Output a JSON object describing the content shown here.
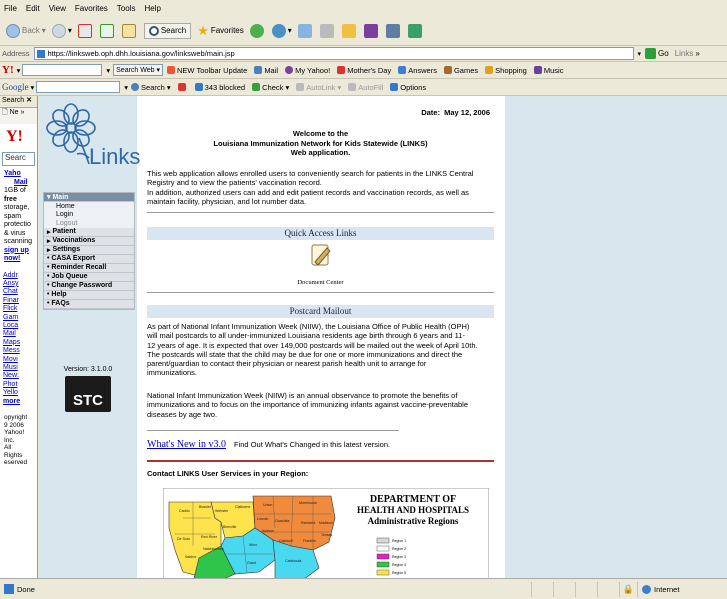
{
  "menubar": {
    "items": [
      "File",
      "Edit",
      "View",
      "Favorites",
      "Tools",
      "Help"
    ]
  },
  "toolbar": {
    "back_label": "Back",
    "search_label": "Search",
    "favorites_label": "Favorites"
  },
  "address": {
    "label": "Address",
    "url": "https://linksweb.oph.dhh.louisiana.gov/linksweb/main.jsp",
    "go_label": "Go",
    "links_label": "Links"
  },
  "yahoo_toolbar": {
    "search_web_label": "Search Web",
    "items": [
      "NEW Toolbar Update",
      "Mail",
      "My Yahoo!",
      "Mother's Day",
      "Answers",
      "Games",
      "Shopping",
      "Music"
    ]
  },
  "google_toolbar": {
    "logo": "Google",
    "search_label": "Search",
    "blocked_label": "343 blocked",
    "check_label": "Check",
    "autolink_label": "AutoLink",
    "autofill_label": "AutoFill",
    "options_label": "Options"
  },
  "side_panel": {
    "header": "Search",
    "search_placeholder": "Searc",
    "promo_lines": [
      "Yaho",
      "Mail",
      "1GB of",
      "free",
      "storage,",
      "spam",
      "protectio",
      "& virus",
      "scanning",
      "sign up",
      "now!"
    ],
    "links": [
      "Addr",
      "Ansy",
      "Chat",
      "Finar",
      "Flick",
      "Gam",
      "Loca",
      "Mail",
      "Maps",
      "Mess",
      "Movi",
      "Musi",
      "New:",
      "Phot",
      "Yello",
      "more"
    ],
    "copyright": [
      "opyright",
      "9 2006",
      "Yahoo!",
      "Inc.",
      "All",
      "Rights",
      "eserved"
    ]
  },
  "nav": {
    "logo_text": "Links",
    "main_label": "Main",
    "sub_items": [
      "Home",
      "Login",
      "Logout"
    ],
    "items": [
      "Patient",
      "Vaccinations",
      "Settings",
      "CASA Export",
      "Reminder Recall",
      "Job Queue",
      "Change Password",
      "Help",
      "FAQs"
    ],
    "version": "Version: 3.1.0.0",
    "stc_logo": "STC"
  },
  "content": {
    "date_label": "Date:",
    "date_value": "May 12, 2006",
    "welcome_lines": [
      "Welcome to the",
      "Louisiana Immunization Network for Kids Statewide (LINKS)",
      "Web application."
    ],
    "intro_lines": [
      "This web application allows enrolled users to conveniently search for patients in the LINKS Central",
      "Registry and to view the patients' vaccination record.",
      "In addition, authorized users can add and edit patient records and vaccination records, as well as",
      "maintain facility, physician, and lot number data."
    ],
    "quick_access_heading": "Quick Access Links",
    "document_center_label": "Document Center",
    "postcard_heading": "Postcard Mailout",
    "postcard_p1_lines": [
      "As part of National Infant Immunization Week (NIIW), the Louisiana Office of Public Health (OPH)",
      "will mail postcards to all under-immunized Louisiana residents age birth through 6 years and 11-",
      "12 years of age. It is expected that over 149,000 postcards will be mailed out the week of April 10th.",
      "The postcards will state that the child may be due for one or more immunizations and direct the",
      "parent/guardian to contact their physician or nearest parish health unit to arrange for",
      "immunizations."
    ],
    "postcard_p2_lines": [
      "National Infant Immunization Week (NIIW) is an annual observance to promote the benefits of",
      "immunizations and to focus on the importance of immunizing infants against vaccine-preventable",
      "diseases by age two."
    ],
    "whats_new_link": "What's New in v3.0",
    "whats_new_desc": "Find Out What's Changed in this latest version.",
    "contact_heading": "Contact LINKS User Services in your Region:",
    "map_title_lines": [
      "DEPARTMENT OF",
      "HEALTH AND HOSPITALS",
      "Administrative Regions"
    ],
    "legend": [
      "Region 1",
      "Region 2",
      "Region 3",
      "Region 4",
      "Region 5"
    ],
    "parish_labels": [
      "Caddo",
      "Bossier",
      "Webster",
      "Claiborne",
      "Union",
      "Morehouse",
      "Ouachita",
      "Richland",
      "Lincoln",
      "Jackson",
      "Bienville",
      "De Soto",
      "Red River",
      "Natchitoches",
      "Sabine",
      "Winn",
      "Grant",
      "Caldwell",
      "Franklin",
      "Tensas",
      "Catahoula",
      "Madison"
    ]
  },
  "statusbar": {
    "left": "Done",
    "right": "Internet"
  },
  "colors": {
    "nav_bg": "#d8e6ee",
    "section_bg": "#d9e6f2",
    "region_yellow": "#ffe34d",
    "region_orange": "#f08a3c",
    "region_cyan": "#48d8f0",
    "region_green": "#2fc44a",
    "region_gray": "#d8d8d8"
  }
}
